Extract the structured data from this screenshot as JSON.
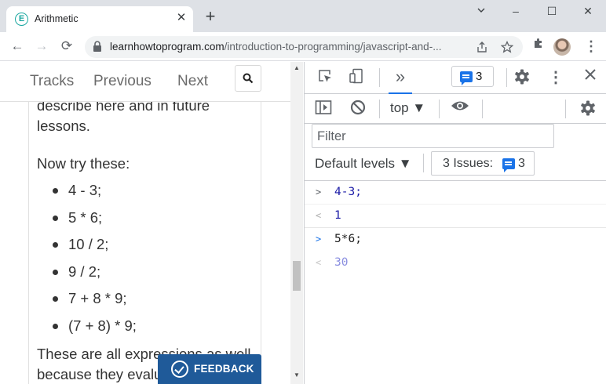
{
  "browser": {
    "tab": {
      "title": "Arithmetic",
      "favicon_letter": "E",
      "close": "✕"
    },
    "new_tab": "+",
    "window": {
      "minimize": "–",
      "maximize": "☐",
      "close": "✕"
    },
    "nav": {
      "back": "←",
      "forward": "→",
      "reload": "⟳"
    },
    "address": {
      "host": "learnhowtoprogram.com",
      "path": "/introduction-to-programming/javascript-and-..."
    },
    "icons": [
      "share-icon",
      "star-icon",
      "extensions-icon",
      "profile-avatar",
      "menu-icon"
    ],
    "menu": "⋮"
  },
  "site": {
    "nav": {
      "tracks": "Tracks",
      "previous": "Previous",
      "next": "Next"
    },
    "paragraph1": "describe here and in future lessons.",
    "paragraph2": "Now try these:",
    "expressions": [
      "4 - 3;",
      "5 * 6;",
      "10 / 2;",
      "9 / 2;",
      "7 + 8 * 9;",
      "(7 + 8) * 9;"
    ],
    "paragraph3": "These are all expressions as well because they evaluate to a value.",
    "feedback": "FEEDBACK"
  },
  "devtools": {
    "issues_count": "3",
    "context": "top",
    "filter_placeholder": "Filter",
    "levels": "Default levels",
    "issues_label": "3 Issues:",
    "issues_btn_count": "3",
    "console": [
      {
        "kind": "input",
        "prefix": ">",
        "text": "4-3;"
      },
      {
        "kind": "output",
        "prefix": "<",
        "text": "1"
      },
      {
        "kind": "input",
        "prefix": ">",
        "text": "5*6;"
      },
      {
        "kind": "eager",
        "prefix": "<",
        "text": "30"
      }
    ]
  },
  "colors": {
    "accent": "#1a73e8",
    "feedback_bg": "#1f5a99",
    "console_input": "#1a1aa6",
    "console_output": "#1a1aa6",
    "console_eager": "#8a8ee0",
    "favicon": "#1aa7a0"
  }
}
